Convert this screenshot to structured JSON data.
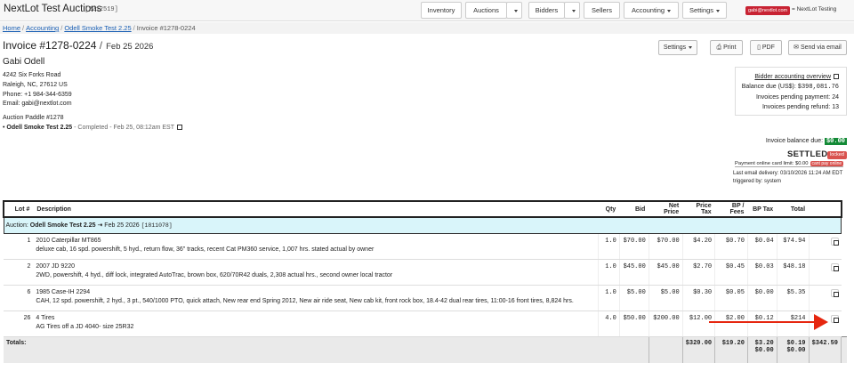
{
  "nav": {
    "brand": "NextLot Test Auctions",
    "brand_id": "[2212519]",
    "inventory": "Inventory",
    "auctions": "Auctions",
    "bidders": "Bidders",
    "sellers": "Sellers",
    "accounting": "Accounting",
    "settings": "Settings",
    "user_badge": "gabi@nextlot.com",
    "company": "= NextLot Testing"
  },
  "breadcrumb": {
    "home": "Home",
    "accounting": "Accounting",
    "auction": "Odell Smoke Test 2.25",
    "current": "Invoice #1278-0224"
  },
  "header": {
    "title": "Invoice #1278-0224",
    "date": "Feb 25 2026",
    "settings_label": "Settings",
    "print_label": "Print",
    "pdf_label": "PDF",
    "email_label": "Send via email"
  },
  "bidder": {
    "name": "Gabi Odell",
    "address1": "4242 Six Forks Road",
    "address2": "Raleigh, NC, 27612 US",
    "phone": "Phone: +1 984-344-6359",
    "email": "Email: gabi@nextlot.com",
    "paddle": "Auction Paddle #1278",
    "auction_name": "Odell Smoke Test 2.25",
    "auction_meta": "- Completed - Feb 25, 08:12am EST"
  },
  "summary": {
    "link": "Bidder accounting overview",
    "balance_label": "Balance due (US$):",
    "balance_value": "$398,081.76",
    "pending_payment_label": "Invoices pending payment:",
    "pending_payment_value": "24",
    "pending_refund_label": "Invoices pending refund:",
    "pending_refund_value": "13"
  },
  "status": {
    "invoice_balance_label": "Invoice balance due:",
    "invoice_balance_value": "$0.00",
    "settled": "SETTLED",
    "locked": "locked",
    "payment_limit": "Payment online card limit: $0.00",
    "cant_pay": "cant pay online",
    "last_email": "Last email delivery: 03/10/2026 11:24 AM EDT",
    "triggered": "triggered by: system"
  },
  "table": {
    "headers": [
      "Lot #",
      "Description",
      "Qty",
      "Bid",
      "Net Price",
      "Price Tax",
      "BP / Fees",
      "BP Tax",
      "Total"
    ],
    "auction_row": {
      "prefix": "Auction:",
      "name": "Odell Smoke Test 2.25",
      "date": "⇥ Feb 25 2026",
      "id": "[1811078]"
    },
    "rows": [
      {
        "lot": "1",
        "title": "2010 Caterpillar MT865",
        "detail": "deluxe cab, 16 spd. powershift, 5 hyd., return flow, 36\" tracks, recent Cat PM360 service, 1,007 hrs. stated actual by owner",
        "qty": "1.0",
        "bid": "$70.00",
        "net": "$70.00",
        "tax": "$4.20",
        "bp": "$0.70",
        "bptax": "$0.04",
        "total": "$74.94"
      },
      {
        "lot": "2",
        "title": "2007 JD 9220",
        "detail": "2WD, powershift, 4 hyd., diff lock, integrated AutoTrac, brown box, 620/70R42 duals, 2,308 actual hrs., second owner local tractor",
        "qty": "1.0",
        "bid": "$45.00",
        "net": "$45.00",
        "tax": "$2.70",
        "bp": "$0.45",
        "bptax": "$0.03",
        "total": "$48.18"
      },
      {
        "lot": "6",
        "title": "1985 Case-IH 2294",
        "detail": "CAH, 12 spd. powershift, 2 hyd., 3 pt., 540/1000 PTO, quick attach, New rear end Spring 2012, New air ride seat, New cab kit, front rock box, 18.4-42 dual rear tires, 11:00-16 front tires, 8,824 hrs.",
        "qty": "1.0",
        "bid": "$5.00",
        "net": "$5.00",
        "tax": "$0.30",
        "bp": "$0.05",
        "bptax": "$0.00",
        "total": "$5.35"
      },
      {
        "lot": "26",
        "title": "4 Tires",
        "detail": "AG Tires off a JD 4040- size 25R32",
        "qty": "4.0",
        "bid": "$50.00",
        "net": "$200.00",
        "tax": "$12.00",
        "bp": "$2.00",
        "bptax": "$0.12",
        "total": "$214"
      }
    ],
    "totals": {
      "label": "Totals:",
      "net": "$320.00",
      "tax": "$19.20",
      "bp": "$3.20",
      "bp2": "$0.00",
      "bptax": "$0.19",
      "bptax2": "$0.00",
      "total": "$342.59"
    }
  },
  "colors": {
    "accent_red": "#e6260f",
    "link_blue": "#1a5fb4",
    "auction_row_bg": "#d9f5fa",
    "balance_green": "#138a36"
  }
}
